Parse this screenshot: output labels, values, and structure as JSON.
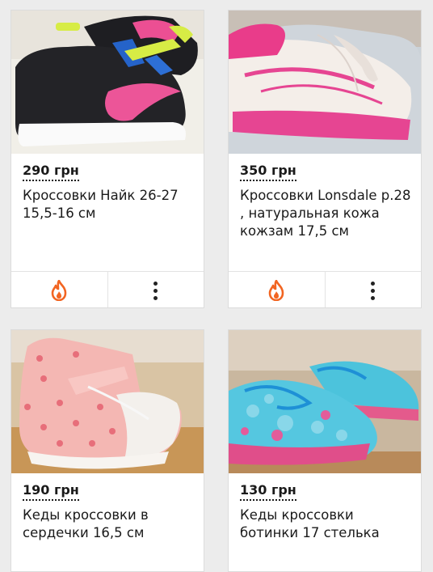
{
  "listings": [
    {
      "price": "290 грн",
      "title": "Кроссовки Найк 26-27 15,5-16 см",
      "photo_icon": "sneaker-photo-black-pink"
    },
    {
      "price": "350 грн",
      "title": "Кроссовки Lonsdale р.28 , натуральная кожа кожзам 17,5 см",
      "photo_icon": "sneaker-photo-white-pink"
    },
    {
      "price": "190 грн",
      "title": "Кеды кроссовки в сердечки 16,5 см",
      "photo_icon": "sneaker-photo-pink-hearts"
    },
    {
      "price": "130 грн",
      "title": "Кеды кроссовки ботинки 17 стелька",
      "photo_icon": "sneaker-photo-blue-glitter"
    }
  ],
  "actions": {
    "promote_icon": "flame-icon",
    "more_icon": "more-vertical-icon"
  },
  "colors": {
    "accent_flame": "#f26522",
    "background": "#ececec",
    "card": "#ffffff",
    "text": "#1a1a1a"
  }
}
